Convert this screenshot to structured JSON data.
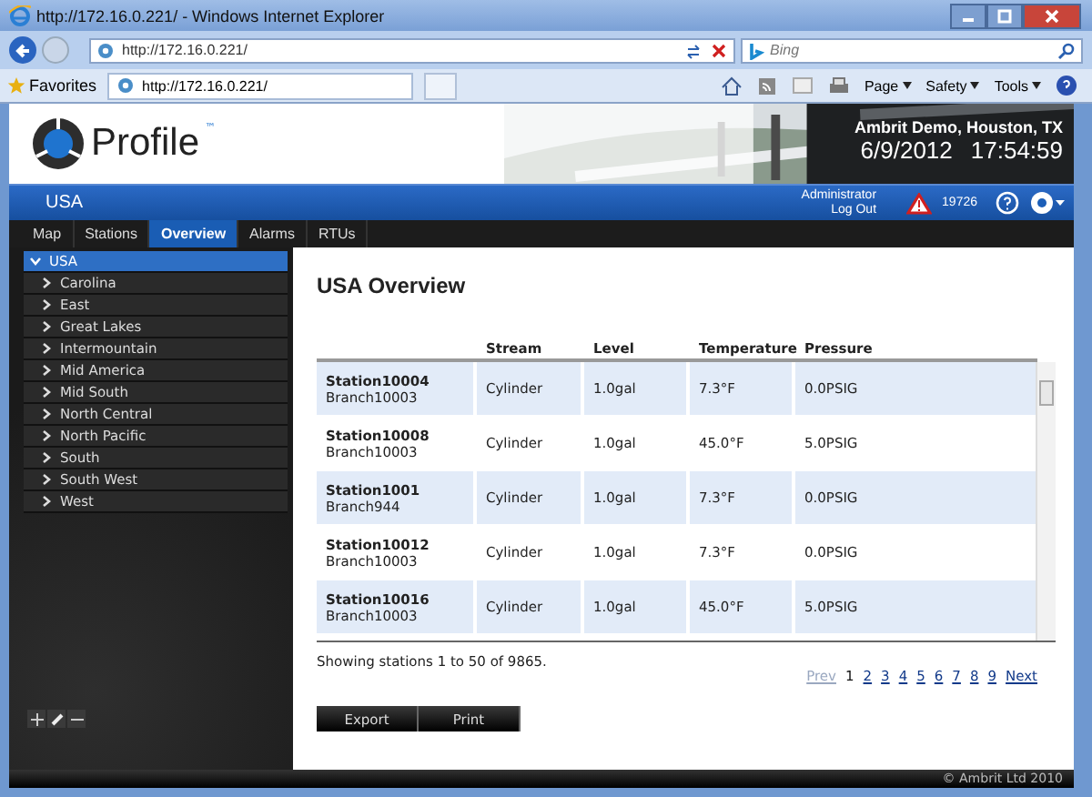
{
  "window": {
    "title": "http://172.16.0.221/ - Windows Internet Explorer"
  },
  "address_bar": {
    "url": "http://172.16.0.221/",
    "search": {
      "placeholder": "Bing"
    }
  },
  "favorites_bar": {
    "favorites": "Favorites",
    "tab": "http://172.16.0.221/",
    "menus": [
      "Page",
      "Safety",
      "Tools"
    ]
  },
  "header": {
    "logo": "Profile",
    "trademark": "™",
    "site": "Ambrit Demo, Houston, TX",
    "date": "6/9/2012",
    "time": "17:54:59"
  },
  "nav_bar": {
    "location": "USA",
    "user": "Administrator",
    "logout": "Log Out",
    "alarm_count": "19726"
  },
  "tabs": [
    {
      "label": "Map",
      "selected": false
    },
    {
      "label": "Stations",
      "selected": false
    },
    {
      "label": "Overview",
      "selected": true
    },
    {
      "label": "Alarms",
      "selected": false
    },
    {
      "label": "RTUs",
      "selected": false
    }
  ],
  "tree": {
    "label": "USA",
    "expanded": true,
    "selected": true,
    "children": [
      {
        "label": "Carolina",
        "expanded": false,
        "selected": false
      },
      {
        "label": "East",
        "expanded": false,
        "selected": false
      },
      {
        "label": "Great Lakes",
        "expanded": false,
        "selected": false
      },
      {
        "label": "Intermountain",
        "expanded": false,
        "selected": false
      },
      {
        "label": "Mid America",
        "expanded": false,
        "selected": false
      },
      {
        "label": "Mid South",
        "expanded": false,
        "selected": false
      },
      {
        "label": "North Central",
        "expanded": false,
        "selected": false
      },
      {
        "label": "North Pacific",
        "expanded": false,
        "selected": false
      },
      {
        "label": "South",
        "expanded": false,
        "selected": false
      },
      {
        "label": "South West",
        "expanded": false,
        "selected": false
      },
      {
        "label": "West",
        "expanded": false,
        "selected": false
      }
    ]
  },
  "content": {
    "title": "USA Overview",
    "columns": [
      "Stream",
      "Level",
      "Temperature",
      "Pressure"
    ],
    "rows": [
      {
        "station": "Station10004",
        "branch": "Branch10003",
        "cells": [
          "Cylinder",
          "1.0gal",
          "7.3°F",
          "0.0PSIG"
        ]
      },
      {
        "station": "Station10008",
        "branch": "Branch10003",
        "cells": [
          "Cylinder",
          "1.0gal",
          "45.0°F",
          "5.0PSIG"
        ]
      },
      {
        "station": "Station1001",
        "branch": "Branch944",
        "cells": [
          "Cylinder",
          "1.0gal",
          "7.3°F",
          "0.0PSIG"
        ]
      },
      {
        "station": "Station10012",
        "branch": "Branch10003",
        "cells": [
          "Cylinder",
          "1.0gal",
          "7.3°F",
          "0.0PSIG"
        ]
      },
      {
        "station": "Station10016",
        "branch": "Branch10003",
        "cells": [
          "Cylinder",
          "1.0gal",
          "45.0°F",
          "5.0PSIG"
        ]
      }
    ],
    "summary": "Showing stations 1 to 50 of 9865.",
    "pagination": {
      "prev": {
        "label": "Prev",
        "disabled": true
      },
      "pages": [
        {
          "label": "1",
          "selected": true
        },
        {
          "label": "2",
          "selected": false
        },
        {
          "label": "3",
          "selected": false
        },
        {
          "label": "4",
          "selected": false
        },
        {
          "label": "5",
          "selected": false
        },
        {
          "label": "6",
          "selected": false
        },
        {
          "label": "7",
          "selected": false
        },
        {
          "label": "8",
          "selected": false
        },
        {
          "label": "9",
          "selected": false
        }
      ],
      "next": {
        "label": "Next",
        "disabled": false
      }
    },
    "buttons": [
      "Export",
      "Print"
    ]
  },
  "footer": "© Ambrit Ltd 2010"
}
